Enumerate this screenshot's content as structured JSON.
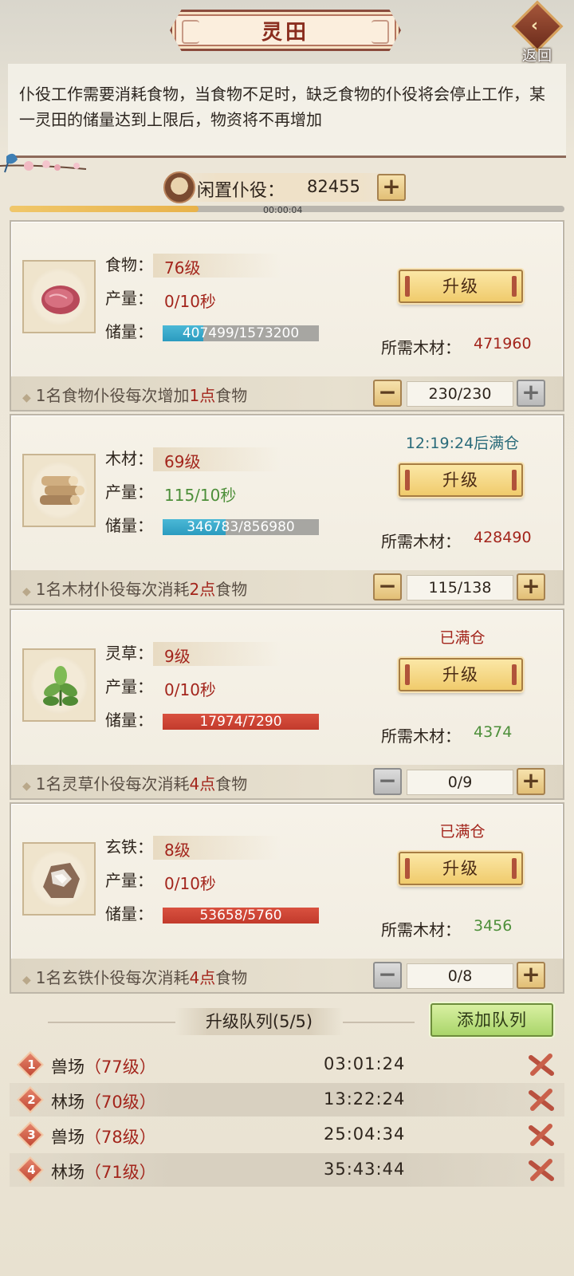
{
  "header": {
    "title": "灵田",
    "back_label": "返回"
  },
  "info_text": "仆役工作需要消耗食物，当食物不足时，缺乏食物的仆役将会停止工作，某一灵田的储量达到上限后，物资将不再增加",
  "idle": {
    "label": "闲置仆役：",
    "count": "82455",
    "timer": "00:00:04",
    "timer_progress": 0.34
  },
  "cards": [
    {
      "name": "食物：",
      "level": "76级",
      "production_label": "产量：",
      "production": "0/10秒",
      "storage_label": "储量：",
      "storage": "407499/1573200",
      "storage_fill": 0.259,
      "bar_color": "blue",
      "status": "",
      "upgrade_label": "升级",
      "need_label": "所需木材：",
      "need_value": "471960",
      "footer_pre": "1名食物仆役每次增加",
      "footer_num": "1点",
      "footer_post": "食物",
      "stepper_value": "230/230",
      "icon": "meat-icon"
    },
    {
      "name": "木材：",
      "level": "69级",
      "production_label": "产量：",
      "production": "115/10秒",
      "storage_label": "储量：",
      "storage": "346783/856980",
      "storage_fill": 0.405,
      "bar_color": "blue",
      "status": "12:19:24后满仓",
      "upgrade_label": "升级",
      "need_label": "所需木材：",
      "need_value": "428490",
      "footer_pre": "1名木材仆役每次消耗",
      "footer_num": "2点",
      "footer_post": "食物",
      "stepper_value": "115/138",
      "icon": "wood-logs-icon"
    },
    {
      "name": "灵草：",
      "level": "9级",
      "production_label": "产量：",
      "production": "0/10秒",
      "storage_label": "储量：",
      "storage": "17974/7290",
      "storage_fill": 1,
      "bar_color": "red",
      "status": "已满仓",
      "upgrade_label": "升级",
      "need_label": "所需木材：",
      "need_value": "4374",
      "footer_pre": "1名灵草仆役每次消耗",
      "footer_num": "4点",
      "footer_post": "食物",
      "stepper_value": "0/9",
      "icon": "herb-icon"
    },
    {
      "name": "玄铁：",
      "level": "8级",
      "production_label": "产量：",
      "production": "0/10秒",
      "storage_label": "储量：",
      "storage": "53658/5760",
      "storage_fill": 1,
      "bar_color": "red",
      "status": "已满仓",
      "upgrade_label": "升级",
      "need_label": "所需木材：",
      "need_value": "3456",
      "footer_pre": "1名玄铁仆役每次消耗",
      "footer_num": "4点",
      "footer_post": "食物",
      "stepper_value": "0/8",
      "icon": "iron-ore-icon"
    }
  ],
  "queue": {
    "title": "升级队列(5/5)",
    "add_label": "添加队列",
    "items": [
      {
        "num": "1",
        "name": "兽场",
        "level": "（77级）",
        "time": "03:01:24"
      },
      {
        "num": "2",
        "name": "林场",
        "level": "（70级）",
        "time": "13:22:24"
      },
      {
        "num": "3",
        "name": "兽场",
        "level": "（78级）",
        "time": "25:04:34"
      },
      {
        "num": "4",
        "name": "林场",
        "level": "（71级）",
        "time": "35:43:44"
      }
    ]
  },
  "colors": {
    "accent_red": "#a3251c",
    "green": "#4d8f3a",
    "teal": "#2a6b7a",
    "bar_blue": "#2b9bbf",
    "bar_red": "#c23a2c"
  }
}
